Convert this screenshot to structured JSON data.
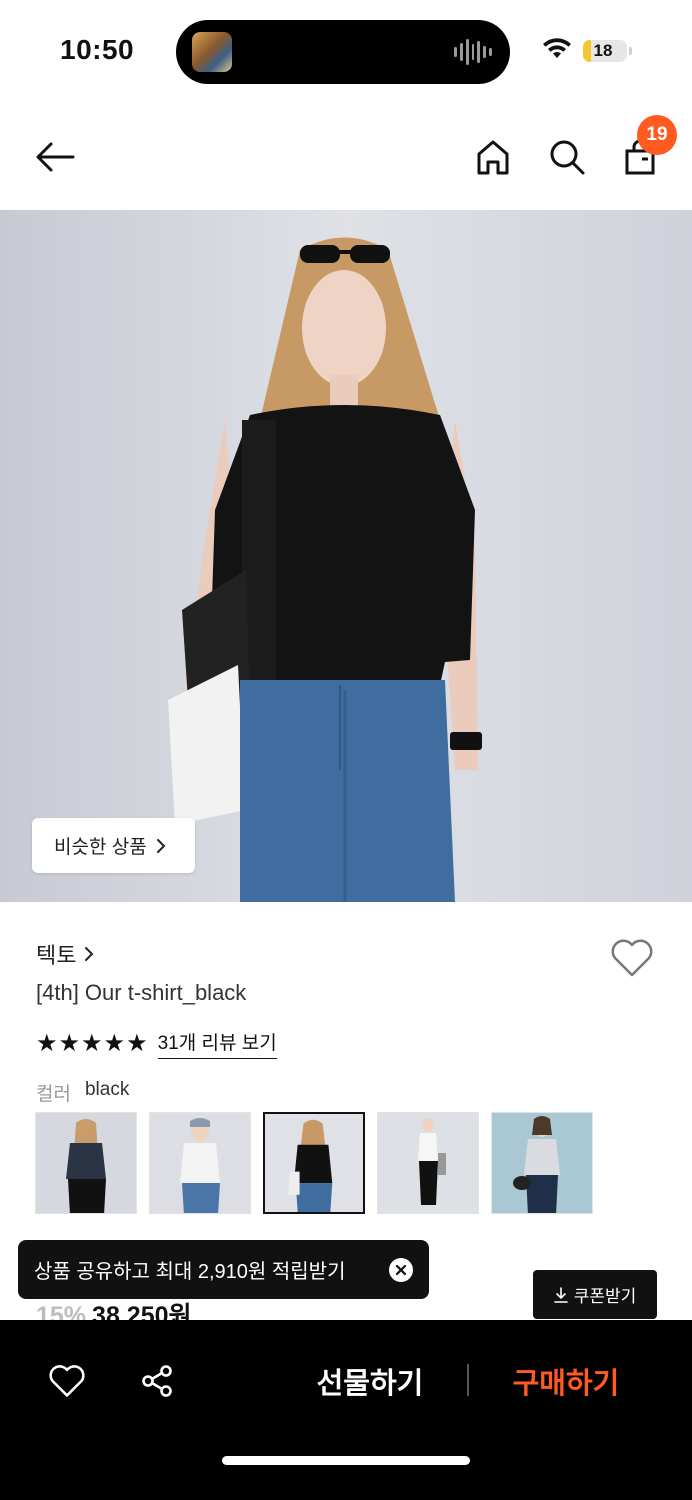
{
  "status_bar": {
    "time": "10:50",
    "battery_level": "18",
    "battery_fraction": 0.18
  },
  "header": {
    "cart_count": "19",
    "icons": [
      "back-arrow-icon",
      "home-icon",
      "search-icon",
      "shopping-bag-icon"
    ]
  },
  "hero": {
    "similar_products_label": "비슷한 상품"
  },
  "product": {
    "brand": "텍토",
    "name": "[4th] Our t-shirt_black",
    "rating_stars": 5,
    "review_link": "31개 리뷰 보기",
    "color_label": "컬러",
    "color_value": "black",
    "discount": "15%",
    "price": "38,250원"
  },
  "tooltip": {
    "text": "상품 공유하고 최대 2,910원 적립받기"
  },
  "coupon": {
    "label": "쿠폰받기"
  },
  "bottom_bar": {
    "gift_label": "선물하기",
    "buy_label": "구매하기"
  },
  "colors": {
    "accent": "#ff5a1f",
    "dark": "#111111",
    "muted": "#999999"
  }
}
